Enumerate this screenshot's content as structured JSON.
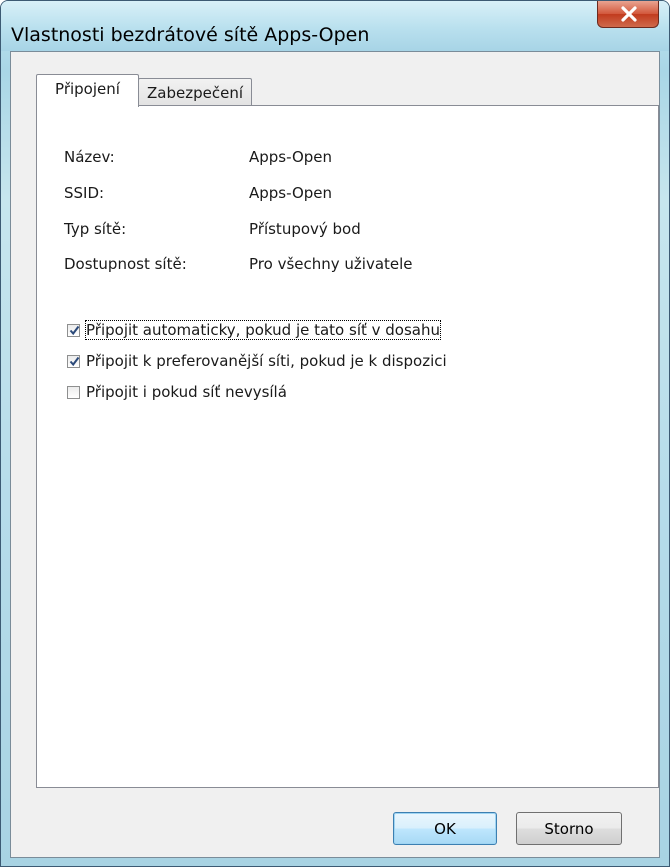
{
  "window": {
    "title": "Vlastnosti bezdrátové sítě Apps-Open"
  },
  "tabs": [
    {
      "label": "Připojení",
      "active": true
    },
    {
      "label": "Zabezpečení",
      "active": false
    }
  ],
  "properties": [
    {
      "label": "Název:",
      "value": "Apps-Open"
    },
    {
      "label": "SSID:",
      "value": "Apps-Open"
    },
    {
      "label": "Typ sítě:",
      "value": "Přístupový bod"
    },
    {
      "label": "Dostupnost sítě:",
      "value": "Pro všechny uživatele"
    }
  ],
  "options": [
    {
      "label": "Připojit automaticky, pokud je tato síť v dosahu",
      "checked": true
    },
    {
      "label": "Připojit k preferovanější síti, pokud je k dispozici",
      "checked": true
    },
    {
      "label": "Připojit i pokud síť nevysílá",
      "checked": false
    }
  ],
  "buttons": {
    "ok": "OK",
    "cancel": "Storno"
  },
  "icons": {
    "close": "close-icon",
    "check": "checkmark-icon"
  },
  "colors": {
    "close_button": "#c13b1e",
    "checkmark": "#2c4a7a",
    "ok_border": "#3c7fb1"
  }
}
